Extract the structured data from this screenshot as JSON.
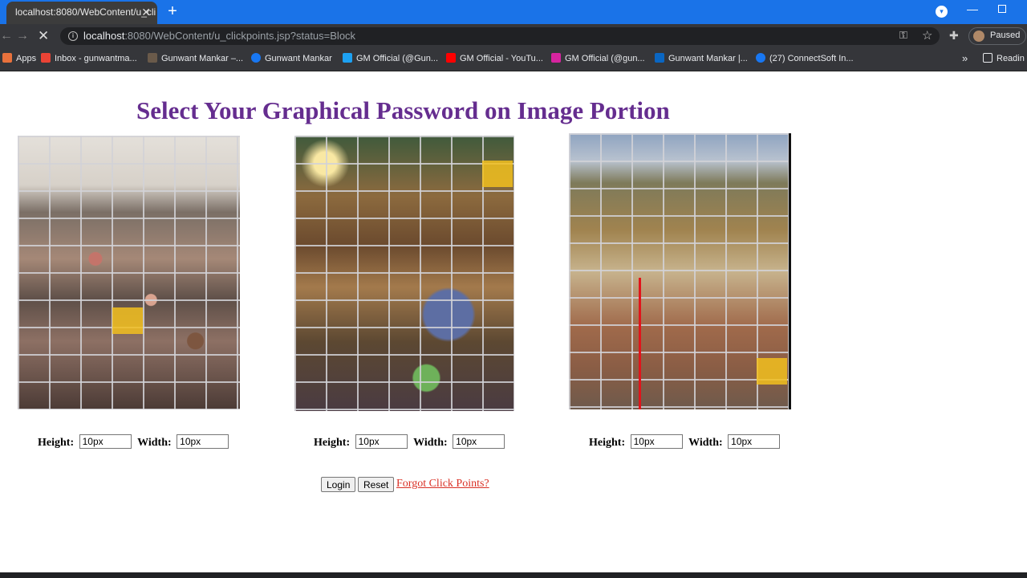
{
  "browser": {
    "tab_title": "localhost:8080/WebContent/u_cli",
    "url_host": "localhost",
    "url_rest": ":8080/WebContent/u_clickpoints.jsp?status=Block",
    "profile_status": "Paused",
    "accent_color": "#1a73e8"
  },
  "bookmarks": [
    {
      "label": "Apps",
      "icon": "apps-grid-icon",
      "color": "#e8713c"
    },
    {
      "label": "Inbox - gunwantma...",
      "icon": "gmail-icon",
      "color": "#ea4335"
    },
    {
      "label": "Gunwant Mankar –...",
      "icon": "profile-icon",
      "color": "#6a5a4a"
    },
    {
      "label": "Gunwant Mankar",
      "icon": "facebook-icon",
      "color": "#1877f2"
    },
    {
      "label": "GM Official (@Gun...",
      "icon": "twitter-icon",
      "color": "#1da1f2"
    },
    {
      "label": "GM Official - YouTu...",
      "icon": "youtube-icon",
      "color": "#ff0000"
    },
    {
      "label": "GM Official (@gun...",
      "icon": "instagram-icon",
      "color": "#d6249f"
    },
    {
      "label": "Gunwant Mankar |...",
      "icon": "linkedin-icon",
      "color": "#0a66c2"
    },
    {
      "label": "(27) ConnectSoft In...",
      "icon": "facebook-icon",
      "color": "#1877f2"
    },
    {
      "label": "Readin",
      "icon": "reading-list-icon",
      "color": "#e8eaed"
    }
  ],
  "page": {
    "title": "Select Your Graphical Password on Image Portion",
    "title_color": "#652d8f",
    "images": [
      {
        "alt": "crowd on steps",
        "dims": {
          "height_label": "Height:",
          "height_value": "10px",
          "width_label": "Width:",
          "width_value": "10px"
        }
      },
      {
        "alt": "fantasy library shelves",
        "dims": {
          "height_label": "Height:",
          "height_value": "10px",
          "width_label": "Width:",
          "width_value": "10px"
        }
      },
      {
        "alt": "hillside town",
        "dims": {
          "height_label": "Height:",
          "height_value": "10px",
          "width_label": "Width:",
          "width_value": "10px"
        }
      }
    ],
    "buttons": {
      "login": "Login",
      "reset": "Reset"
    },
    "forgot_link": "Forgot Click Points?",
    "highlight_color": "#f2c01e",
    "marker_color": "#e1141b"
  }
}
